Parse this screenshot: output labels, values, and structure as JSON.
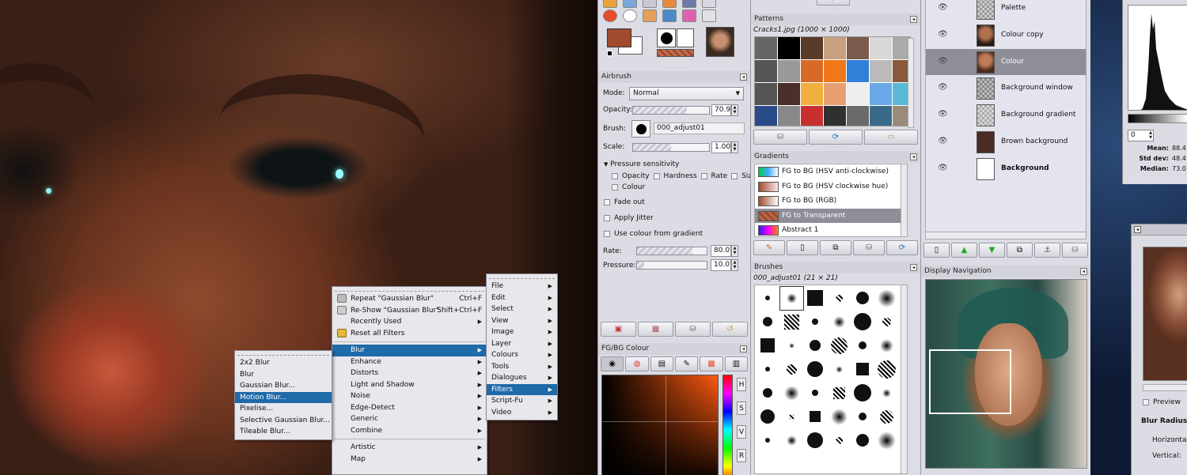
{
  "filters_menu": {
    "items": [
      {
        "label": "Repeat \"Gaussian Blur\"",
        "accel": "Ctrl+F",
        "icon": "repeat-icon"
      },
      {
        "label": "Re-Show \"Gaussian Blur\"",
        "accel": "Shift+Ctrl+F",
        "icon": "reshow-icon"
      },
      {
        "label": "Recently Used",
        "submenu": true
      },
      {
        "label": "Reset all Filters",
        "icon": "reset-icon"
      }
    ],
    "categories": [
      "Blur",
      "Enhance",
      "Distorts",
      "Light and Shadow",
      "Noise",
      "Edge-Detect",
      "Generic",
      "Combine"
    ],
    "more": [
      "Artistic",
      "Map"
    ],
    "highlighted": "Blur"
  },
  "blur_menu": {
    "items": [
      "2x2 Blur",
      "Blur",
      "Gaussian Blur...",
      "Motion Blur...",
      "Pixelise...",
      "Selective Gaussian Blur...",
      "Tileable Blur..."
    ],
    "highlighted": "Motion Blur..."
  },
  "main_menu": {
    "items": [
      "File",
      "Edit",
      "Select",
      "View",
      "Image",
      "Layer",
      "Colours",
      "Tools",
      "Dialogues",
      "Filters",
      "Script-Fu",
      "Video"
    ],
    "highlighted": "Filters"
  },
  "toolbox": {
    "fg_color": "#a04a2e",
    "bg_color": "#ffffff"
  },
  "airbrush": {
    "title": "Airbrush",
    "mode_label": "Mode:",
    "mode_value": "Normal",
    "opacity_label": "Opacity:",
    "opacity_value": "70.9",
    "opacity": 70.9,
    "brush_label": "Brush:",
    "brush_value": "000_adjust01",
    "scale_label": "Scale:",
    "scale_value": "1.00",
    "scale": 0.5,
    "pressure_sensitivity": "Pressure sensitivity",
    "ps_opacity": "Opacity",
    "ps_hardness": "Hardness",
    "ps_rate": "Rate",
    "ps_size": "Size",
    "ps_colour": "Colour",
    "fade_out": "Fade out",
    "apply_jitter": "Apply Jitter",
    "use_colour_from_gradient": "Use colour from gradient",
    "rate_label": "Rate:",
    "rate_value": "80.0",
    "rate": 80,
    "pressure_label": "Pressure:",
    "pressure_value": "10.0",
    "pressure": 10
  },
  "fgbg": {
    "title": "FG/BG Colour",
    "side_letters": [
      "H",
      "S",
      "V",
      "R"
    ]
  },
  "patterns": {
    "title": "Patterns",
    "current": "Cracks1.jpg (1000 × 1000)"
  },
  "gradients": {
    "title": "Gradients",
    "items": [
      {
        "name": "FG to BG (HSV anti-clockwise)",
        "selected": false
      },
      {
        "name": "FG to BG (HSV clockwise hue)",
        "selected": false
      },
      {
        "name": "FG to BG (RGB)",
        "selected": false
      },
      {
        "name": "FG to Transparent",
        "selected": true
      },
      {
        "name": "Abstract 1",
        "selected": false
      }
    ]
  },
  "brushes": {
    "title": "Brushes",
    "current": "000_adjust01 (21 × 21)"
  },
  "layers": {
    "items": [
      {
        "name": "Palette",
        "selected": false,
        "bold": false
      },
      {
        "name": "Colour copy",
        "selected": false,
        "bold": false
      },
      {
        "name": "Colour",
        "selected": true,
        "bold": false
      },
      {
        "name": "Background window",
        "selected": false,
        "bold": false
      },
      {
        "name": "Background gradient",
        "selected": false,
        "bold": false
      },
      {
        "name": "Brown background",
        "selected": false,
        "bold": false
      },
      {
        "name": "Background",
        "selected": false,
        "bold": true
      }
    ]
  },
  "navigation": {
    "title": "Display Navigation"
  },
  "histogram": {
    "spin_value": "0",
    "mean_label": "Mean:",
    "mean_value": "88.4",
    "std_label": "Std dev:",
    "std_value": "48.4",
    "median_label": "Median:",
    "median_value": "73.0"
  },
  "blur_dialog": {
    "preview_label": "Preview",
    "blur_radius_label": "Blur Radius",
    "horizontal_label": "Horizontal:",
    "vertical_label": "Vertical:"
  }
}
